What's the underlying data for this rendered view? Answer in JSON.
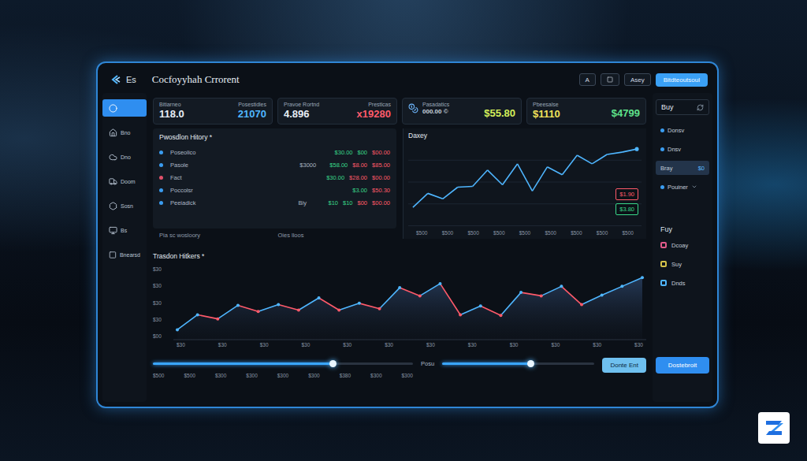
{
  "window": {
    "logo": "Es",
    "title": "Cocfoyyhah Crrorent"
  },
  "toolbar": {
    "buttons": [
      "A",
      "Asey"
    ],
    "primary": "Bitdteoutsoul"
  },
  "sidebar": {
    "items": [
      {
        "selected": true
      },
      {
        "label": "Bno",
        "selected": false
      },
      {
        "label": "Dno",
        "selected": false
      },
      {
        "label": "Doom",
        "selected": false
      },
      {
        "label": "Sosn",
        "selected": false
      },
      {
        "label": "Bs",
        "selected": false
      },
      {
        "label": "Bnearsd",
        "selected": false
      }
    ]
  },
  "cards": [
    {
      "kind": "plain",
      "metrics": [
        {
          "label": "Bitiarneo",
          "value": "118.0",
          "color": "#e8eef6"
        },
        {
          "label": "Posestidles",
          "value": "21070",
          "color": "#4fb6ff"
        }
      ]
    },
    {
      "kind": "plain",
      "metrics": [
        {
          "label": "Pravoe Rortnd",
          "value": "4.896",
          "color": "#e8eef6"
        },
        {
          "label": "Prestlcas",
          "value": "x19280",
          "color": "#ff5a6a"
        }
      ]
    },
    {
      "kind": "coin",
      "metrics": [
        {
          "label": "Pasadatics",
          "value": "000.00 ©",
          "color": "#c9d3df"
        },
        {
          "value": "$55.80",
          "color": "#d4ef5a"
        }
      ]
    },
    {
      "kind": "plain",
      "metrics": [
        {
          "label": "Pbeesalse",
          "value": "$1110",
          "color": "#f2e25a"
        },
        {
          "value": "$4799",
          "color": "#5fe08a"
        }
      ]
    }
  ],
  "transactions": {
    "title": "Pwosdlon Hitory *",
    "rows": [
      {
        "name": "Poseolico",
        "type": "",
        "color": "#3a9cf0",
        "values": [
          {
            "text": "$30.00",
            "color": "#39d98a"
          },
          {
            "text": "$00",
            "color": "#39d98a"
          },
          {
            "text": "$00.00",
            "color": "#ff5a6a"
          }
        ]
      },
      {
        "name": "Pasole",
        "type": "$3000",
        "color": "#3a9cf0",
        "values": [
          {
            "text": "$58.00",
            "color": "#39d98a"
          },
          {
            "text": "$8.00",
            "color": "#ff5a6a"
          },
          {
            "text": "$85.00",
            "color": "#ff5a6a"
          }
        ]
      },
      {
        "name": "Fact",
        "type": "",
        "color": "#e0506a",
        "values": [
          {
            "text": "$30.00",
            "color": "#39d98a"
          },
          {
            "text": "$28.00",
            "color": "#ff5a6a"
          },
          {
            "text": "$00.00",
            "color": "#ff5a6a"
          }
        ]
      },
      {
        "name": "Poccolsr",
        "type": "",
        "color": "#3a9cf0",
        "values": [
          {
            "text": "$3.00",
            "color": "#39d98a"
          },
          {
            "text": "$50.30",
            "color": "#ff5a6a"
          }
        ]
      },
      {
        "name": "Peeiadick",
        "type": "Biy",
        "color": "#3a9cf0",
        "values": [
          {
            "text": "$10",
            "color": "#39d98a"
          },
          {
            "text": "$10",
            "color": "#39d98a"
          },
          {
            "text": "$00",
            "color": "#ff5a6a"
          },
          {
            "text": "$00.00",
            "color": "#ff5a6a"
          }
        ]
      }
    ],
    "footer": [
      "Pia sc wosloory",
      "Oies lloos"
    ]
  },
  "price_chart": {
    "title": "Daxey",
    "series": [
      {
        "values": [
          23,
          41,
          34,
          49,
          50,
          71,
          52,
          79,
          44,
          75,
          65,
          90,
          79,
          91,
          94,
          98
        ],
        "color": "#4fb6ff"
      }
    ],
    "x_ticks": [
      "$500",
      "$500",
      "$500",
      "$500",
      "$500",
      "$500",
      "$500",
      "$500",
      "$500"
    ],
    "badges": [
      {
        "text": "$1.90",
        "color": "#ff5a6a"
      },
      {
        "text": "$3.80",
        "color": "#39d98a"
      }
    ]
  },
  "history_chart": {
    "title": "Trasdon Hitkers *",
    "y_ticks": [
      "$30",
      "$30",
      "$30",
      "$30",
      "$00"
    ],
    "x_ticks": [
      "$30",
      "$30",
      "$30",
      "$30",
      "$30",
      "$30",
      "$30",
      "$30",
      "$30",
      "$30",
      "$30",
      "$30"
    ],
    "series": [
      {
        "values": [
          10,
          32,
          26,
          46,
          37,
          47,
          39,
          57,
          39,
          49,
          41,
          72,
          60,
          78,
          32,
          45,
          31,
          65,
          60,
          74,
          47,
          61,
          74,
          87
        ],
        "up_color": "#4fb6ff",
        "down_color": "#ff5a6a"
      }
    ]
  },
  "controls": {
    "sliders": [
      {
        "level": 0.69
      },
      {
        "label": "Posu",
        "level": 0.58
      }
    ],
    "ticks": [
      "$500",
      "$500",
      "$300",
      "$300",
      "$300",
      "$300",
      "$380",
      "$300",
      "$300"
    ],
    "button": "Donte Ent"
  },
  "right_panel": {
    "title": "Buy",
    "items": [
      {
        "label": "Donsv",
        "selected": false
      },
      {
        "label": "Dnsv",
        "selected": false
      },
      {
        "label": "Bray",
        "value": "$0",
        "selected": true
      },
      {
        "label": "Pouiner",
        "selected": false
      }
    ],
    "section": "Fuy",
    "options": [
      {
        "label": "Dcoay",
        "color": "#e05a8a"
      },
      {
        "label": "Suy",
        "color": "#d4c24a"
      },
      {
        "label": "Dnds",
        "color": "#4fb6ff"
      }
    ],
    "button": "Dostebroit"
  }
}
